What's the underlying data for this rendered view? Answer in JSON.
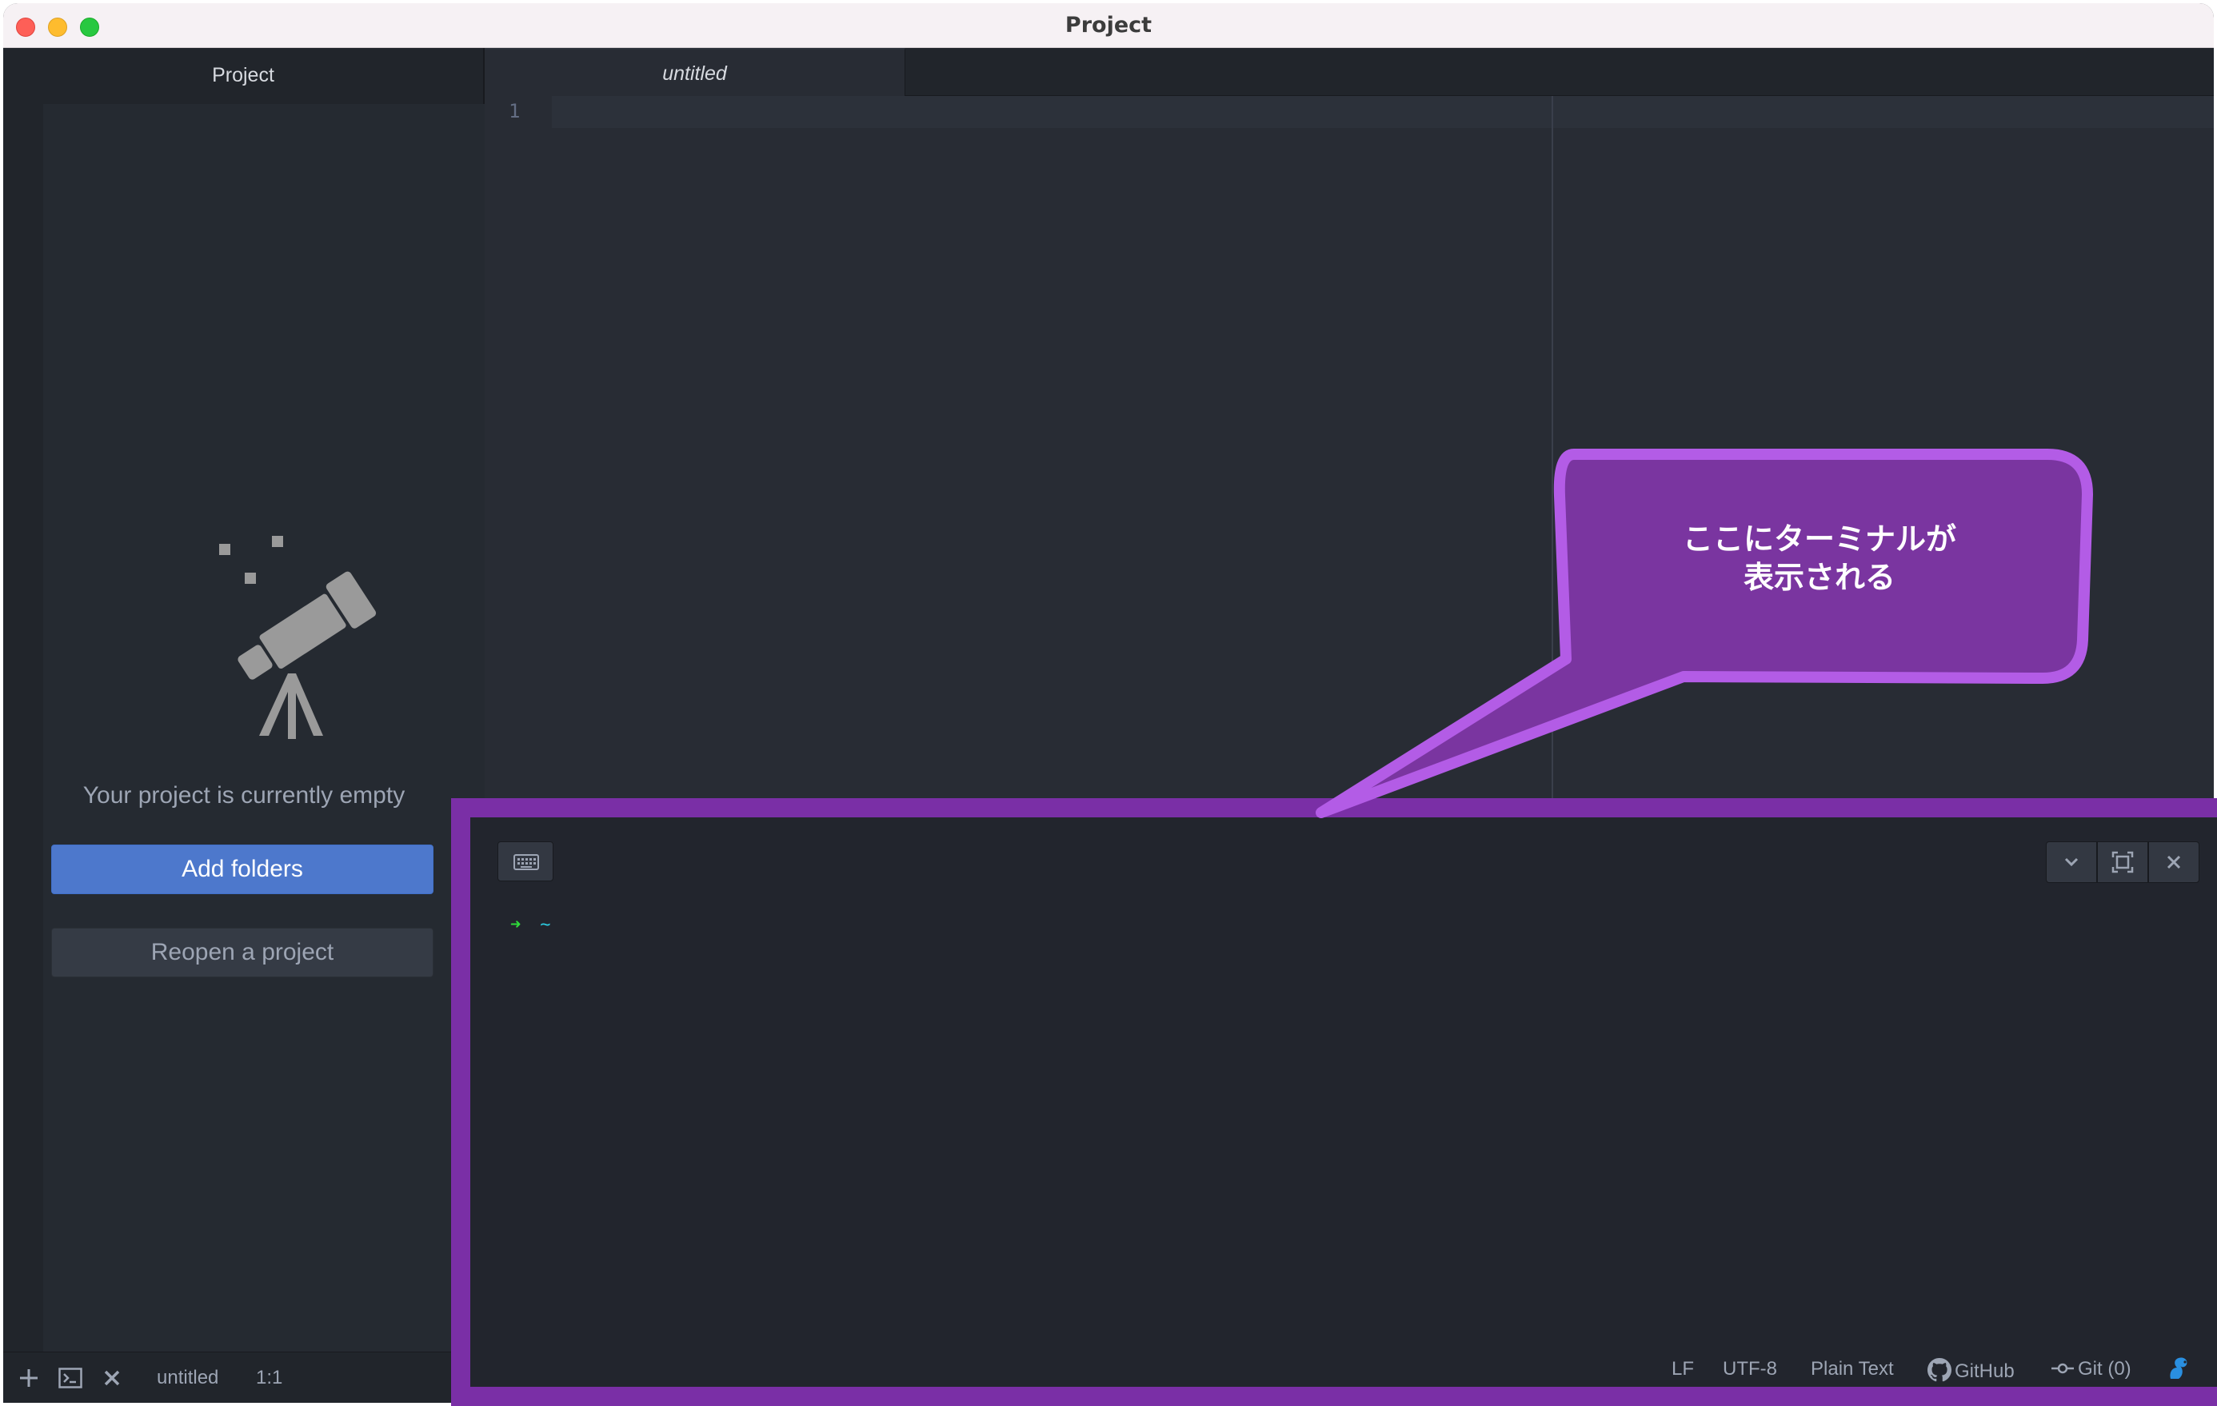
{
  "window": {
    "title": "Project"
  },
  "sidebar": {
    "title": "Project",
    "empty_message": "Your project is currently empty",
    "add_folders_label": "Add folders",
    "reopen_label": "Reopen a project"
  },
  "editor": {
    "tab_label": "untitled",
    "line_number": "1"
  },
  "callout": {
    "line1": "ここにターミナルが",
    "line2": "表示される"
  },
  "terminal": {
    "prompt_arrow": "➜",
    "prompt_dir": "~"
  },
  "status_left": {
    "file": "untitled",
    "cursor": "1:1"
  },
  "status_right": {
    "line_ending": "LF",
    "encoding": "UTF-8",
    "grammar": "Plain Text",
    "github": "GitHub",
    "git": "Git (0)"
  },
  "colors": {
    "accent_button": "#4d78cc",
    "callout_purple": "#7a35a0",
    "callout_border": "#b35ce6",
    "terminal_frame": "#7a2fa6"
  },
  "icons": [
    "telescope-icon",
    "keyboard-icon",
    "chevron-down-icon",
    "maximize-icon",
    "close-icon",
    "plus-icon",
    "terminal-icon",
    "github-icon",
    "git-commit-icon",
    "squirrel-icon"
  ]
}
